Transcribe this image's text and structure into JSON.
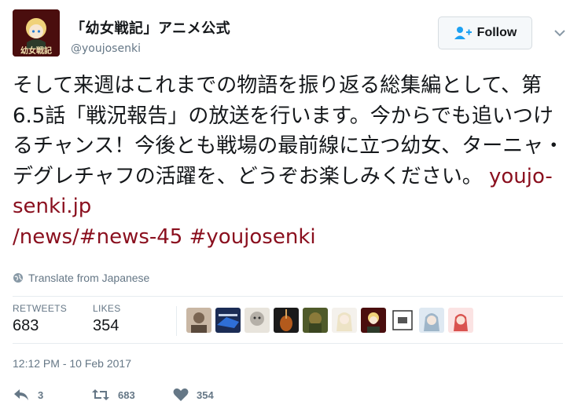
{
  "tweet": {
    "author": {
      "display_name": "「幼女戦記」アニメ公式",
      "handle": "@youjosenki",
      "avatar_text": "幼女戦記",
      "avatar_icon": "anime-character-avatar"
    },
    "follow_label": "Follow",
    "body": {
      "text": "そして来週はこれまでの物語を振り返る総集編として、第6.5話「戦況報告」の放送を行います。今からでも追いつけるチャンス！今後とも戦場の最前線に立つ幼女、ターニャ・デグレチャフの活躍を、どうぞお楽しみください。",
      "link_url": "youjo-senki.jp\n/news/#news-45",
      "hashtag": "#youjosenki"
    },
    "translate_label": "Translate from Japanese",
    "stats": {
      "retweets_label": "RETWEETS",
      "retweets_value": "683",
      "likes_label": "LIKES",
      "likes_value": "354"
    },
    "timestamp": "12:12 PM - 10 Feb 2017",
    "actions": {
      "reply_count": "3",
      "retweet_count": "683",
      "like_count": "354"
    },
    "colors": {
      "link": "#8a0f1e",
      "muted": "#657786",
      "text": "#14171a"
    }
  }
}
